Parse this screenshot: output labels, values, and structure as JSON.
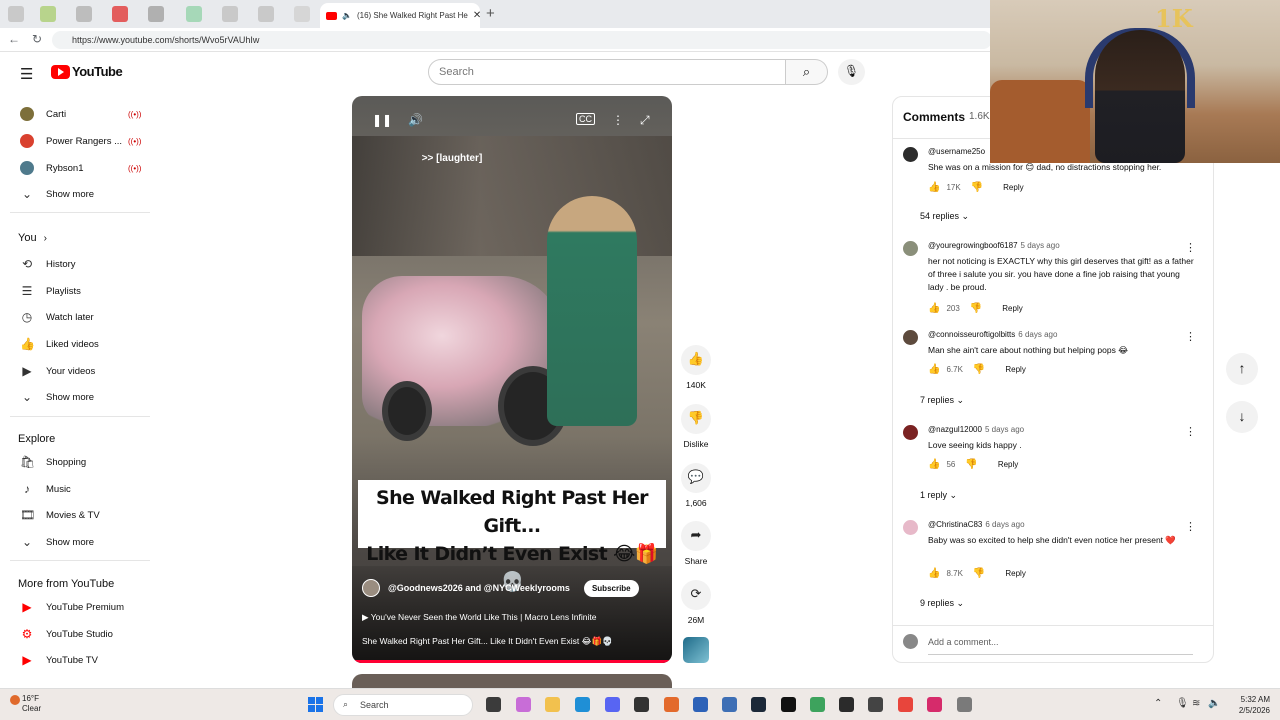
{
  "browser": {
    "active_tab_title": "(16) She Walked Right Past He",
    "url": "https://www.youtube.com/shorts/Wvo5rVAUhIw"
  },
  "header": {
    "logo_text": "YouTube",
    "search_placeholder": "Search"
  },
  "sidebar": {
    "subscriptions": [
      {
        "label": "Carti",
        "live": "((•))"
      },
      {
        "label": "Power Rangers ...",
        "live": "((•))"
      },
      {
        "label": "Rybson1",
        "live": "((•))"
      }
    ],
    "show_more_1": "Show more",
    "you_heading": "You",
    "you_items": [
      "History",
      "Playlists",
      "Watch later",
      "Liked videos",
      "Your videos"
    ],
    "show_more_2": "Show more",
    "explore_heading": "Explore",
    "explore_items": [
      "Shopping",
      "Music",
      "Movies & TV"
    ],
    "show_more_3": "Show more",
    "more_heading": "More from YouTube",
    "more_items": [
      "YouTube Premium",
      "YouTube Studio",
      "YouTube TV"
    ]
  },
  "video": {
    "caption": ">> [laughter]",
    "overlay_title_line1": "She Walked Right Past Her Gift...",
    "overlay_title_line2": "Like It Didn’t Even Exist 😂🎁💀",
    "channels": "@Goodnews2026 and @NYCWeeklyrooms",
    "subscribe_label": "Subscribe",
    "music": "You've Never Seen the World Like This | Macro Lens Infinite",
    "description": "She Walked Right Past Her Gift... Like It Didn't Even Exist 😂🎁💀",
    "progress": 1.0
  },
  "actions": {
    "likes": "140K",
    "dislike": "Dislike",
    "comments": "1,606",
    "share": "Share",
    "remix": "26M"
  },
  "comments_panel": {
    "heading": "Comments",
    "count": "1.6K",
    "comments": [
      {
        "user": "@username25o",
        "time": "",
        "text": "She was on a mission for 😊 dad, no distractions stopping her.",
        "likes": "17K",
        "reply": "Reply",
        "replies": "54 replies"
      },
      {
        "user": "@youregrowingboof6187",
        "time": "5 days ago",
        "text": "her not noticing is EXACTLY why this girl deserves that gift! as a father of three i salute you sir. you have done a fine job raising that young lady . be proud.",
        "likes": "203",
        "reply": "Reply",
        "replies": ""
      },
      {
        "user": "@connoisseuroftigolbitts",
        "time": "6 days ago",
        "text": "Man she ain't care about nothing but helping pops 😂",
        "likes": "6.7K",
        "reply": "Reply",
        "replies": "7 replies"
      },
      {
        "user": "@nazgul12000",
        "time": "5 days ago",
        "text": "Love seeing kids happy .",
        "likes": "56",
        "reply": "Reply",
        "replies": "1 reply"
      },
      {
        "user": "@ChristinaC83",
        "time": "6 days ago",
        "text": "Baby was so excited to help she didn't even notice her present ❤️",
        "likes": "8.7K",
        "reply": "Reply",
        "replies": "9 replies"
      }
    ],
    "add_comment_placeholder": "Add a comment..."
  },
  "webcam": {
    "balloon_text": "1K"
  },
  "taskbar": {
    "temperature": "16°F",
    "weather": "Clear",
    "search_label": "Search",
    "time": "5:32 AM",
    "date": "2/5/2026"
  },
  "colors": {
    "brand_red": "#ff0000",
    "progress_red": "#ff0033",
    "accent_blue": "#1a73e8"
  }
}
